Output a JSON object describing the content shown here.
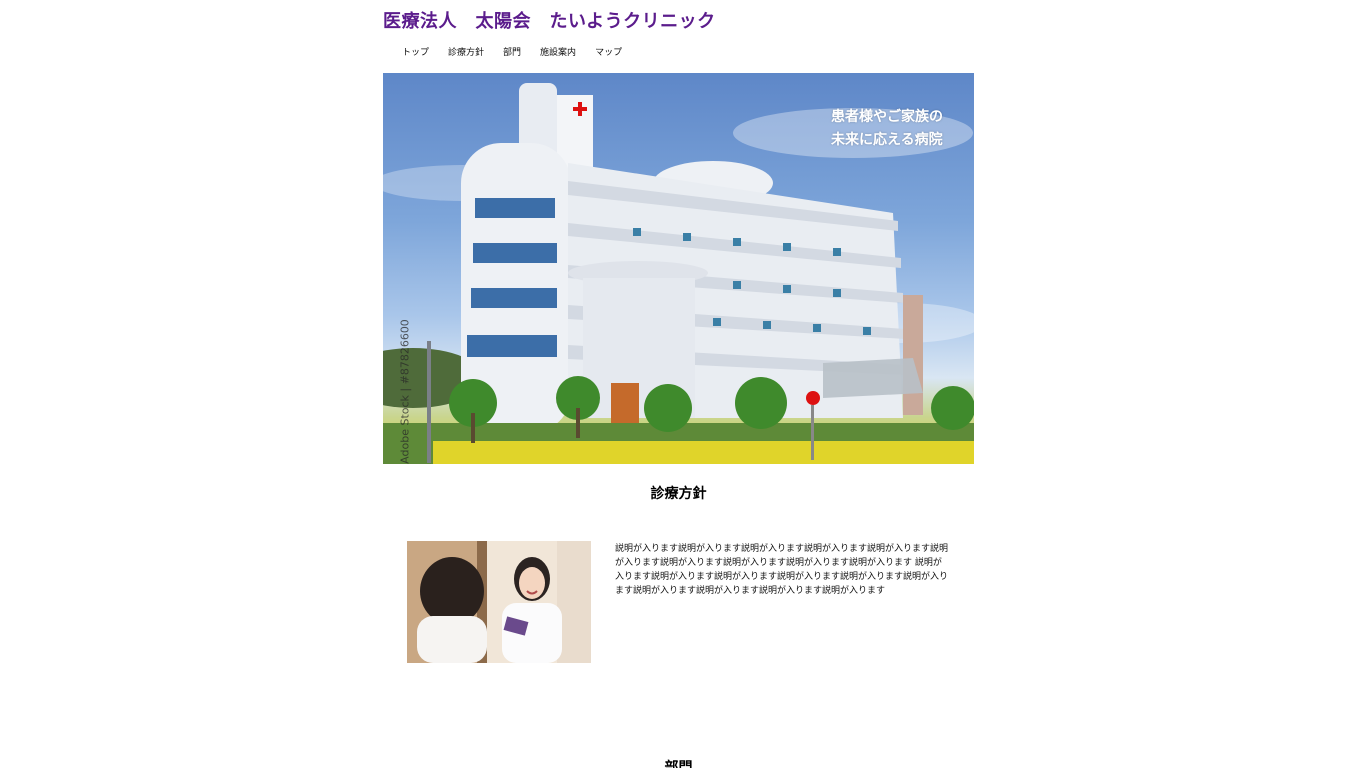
{
  "header": {
    "title": "医療法人　太陽会　たいようクリニック"
  },
  "nav": {
    "items": [
      {
        "label": "トップ"
      },
      {
        "label": "診療方針"
      },
      {
        "label": "部門"
      },
      {
        "label": "施設案内"
      },
      {
        "label": "マップ"
      }
    ]
  },
  "hero": {
    "caption_line1": "患者様やご家族の",
    "caption_line2": "未来に応える病院",
    "watermark": "Adobe Stock | #87826600"
  },
  "policy": {
    "title": "診療方針",
    "description": "説明が入ります説明が入ります説明が入ります説明が入ります説明が入ります説明が入ります説明が入ります説明が入ります説明が入ります説明が入ります 説明が入ります説明が入ります説明が入ります説明が入ります説明が入ります説明が入ります説明が入ります説明が入ります説明が入ります説明が入ります"
  },
  "department": {
    "title": "部門"
  },
  "colors": {
    "title": "#5b1c8c",
    "sky": "#6f9ad4",
    "flowers": "#e0d42a"
  }
}
